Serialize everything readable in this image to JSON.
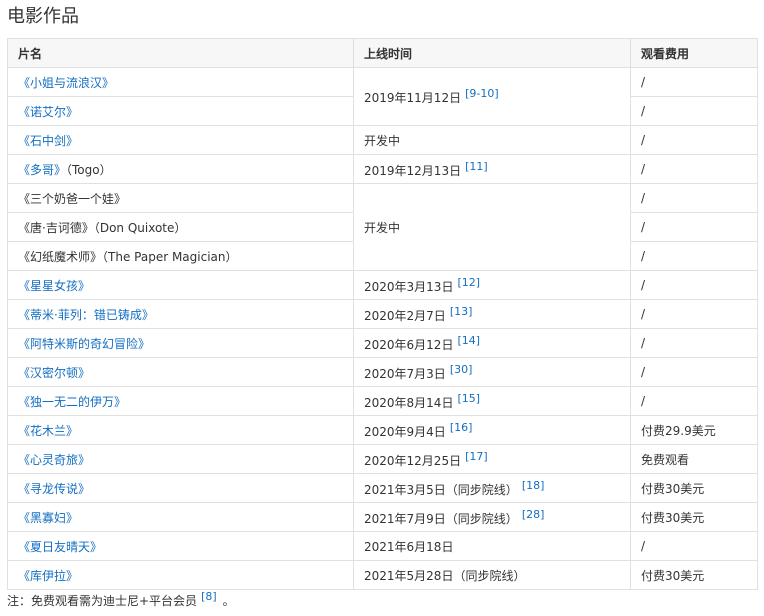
{
  "section_title": "电影作品",
  "columns": {
    "title": "片名",
    "release": "上线时间",
    "fee": "观看费用"
  },
  "rows": [
    {
      "title": "《小姐与流浪汉》",
      "extra": "",
      "linked": true,
      "release": "2019年11月12日",
      "ref": "[9-10]",
      "rowspan": 2,
      "fee": "/"
    },
    {
      "title": "《诺艾尔》",
      "extra": "",
      "linked": true,
      "fee": "/"
    },
    {
      "title": "《石中剑》",
      "extra": "",
      "linked": true,
      "release": "开发中",
      "ref": "",
      "rowspan": 1,
      "fee": "/"
    },
    {
      "title": "《多哥》",
      "extra": "（Togo）",
      "linked": true,
      "release": "2019年12月13日",
      "ref": "[11]",
      "rowspan": 1,
      "fee": "/"
    },
    {
      "title": "《三个奶爸一个娃》",
      "extra": "",
      "linked": false,
      "release": "开发中",
      "ref": "",
      "rowspan": 3,
      "fee": "/"
    },
    {
      "title": "《唐·吉诃德》",
      "extra": "（Don Quixote）",
      "linked": false,
      "fee": "/"
    },
    {
      "title": "《幻纸魔术师》",
      "extra": "（The Paper Magician）",
      "linked": false,
      "fee": "/"
    },
    {
      "title": "《星星女孩》",
      "extra": "",
      "linked": true,
      "release": "2020年3月13日",
      "ref": "[12]",
      "rowspan": 1,
      "fee": "/"
    },
    {
      "title": "《蒂米·菲列：错已铸成》",
      "extra": "",
      "linked": true,
      "release": "2020年2月7日",
      "ref": "[13]",
      "rowspan": 1,
      "fee": "/"
    },
    {
      "title": "《阿特米斯的奇幻冒险》",
      "extra": "",
      "linked": true,
      "release": "2020年6月12日",
      "ref": "[14]",
      "rowspan": 1,
      "fee": "/"
    },
    {
      "title": "《汉密尔顿》",
      "extra": "",
      "linked": true,
      "release": "2020年7月3日",
      "ref": "[30]",
      "rowspan": 1,
      "fee": "/"
    },
    {
      "title": "《独一无二的伊万》",
      "extra": "",
      "linked": true,
      "release": "2020年8月14日",
      "ref": "[15]",
      "rowspan": 1,
      "fee": "/"
    },
    {
      "title": "《花木兰》",
      "extra": "",
      "linked": true,
      "release": "2020年9月4日",
      "ref": "[16]",
      "rowspan": 1,
      "fee": "付费29.9美元"
    },
    {
      "title": "《心灵奇旅》",
      "extra": "",
      "linked": true,
      "release": "2020年12月25日",
      "ref": "[17]",
      "rowspan": 1,
      "fee": "免费观看"
    },
    {
      "title": "《寻龙传说》",
      "extra": "",
      "linked": true,
      "release": "2021年3月5日（同步院线）",
      "ref": "[18]",
      "rowspan": 1,
      "fee": "付费30美元"
    },
    {
      "title": "《黑寡妇》",
      "extra": "",
      "linked": true,
      "release": "2021年7月9日（同步院线）",
      "ref": "[28]",
      "rowspan": 1,
      "fee": "付费30美元"
    },
    {
      "title": "《夏日友晴天》",
      "extra": "",
      "linked": true,
      "release": "2021年6月18日",
      "ref": "",
      "rowspan": 1,
      "fee": "/"
    },
    {
      "title": "《库伊拉》",
      "extra": "",
      "linked": true,
      "release": "2021年5月28日（同步院线）",
      "ref": "",
      "rowspan": 1,
      "fee": "付费30美元"
    }
  ],
  "footnote": {
    "text": "注：免费观看需为迪士尼+平台会员",
    "ref": "[8]",
    "end": "。"
  }
}
